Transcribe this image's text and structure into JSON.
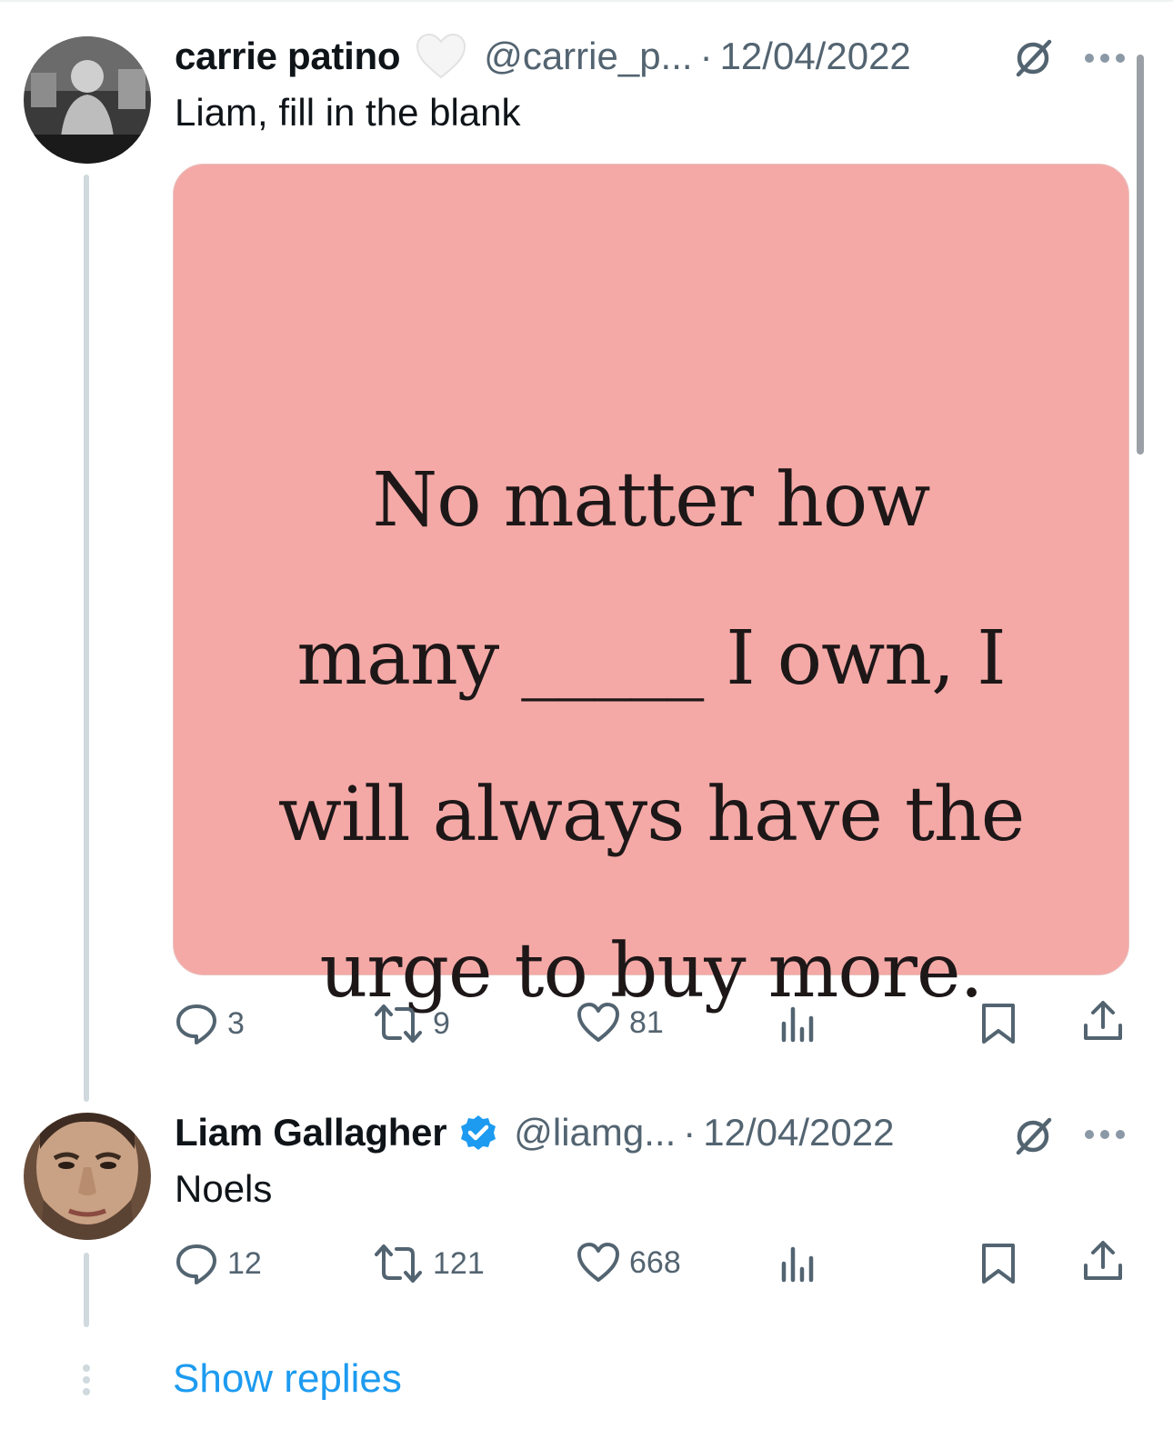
{
  "tweets": [
    {
      "author": "carrie patino",
      "handle": "@carrie_p...",
      "separator": "·",
      "date": "12/04/2022",
      "text": "Liam, fill in the blank",
      "badge": "white-heart-icon",
      "media": {
        "lines": [
          "No matter how",
          "many _____ I own, I",
          "will always have the",
          "urge to buy more."
        ],
        "background": "#f4a9a6"
      },
      "stats": {
        "replies": "3",
        "reposts": "9",
        "likes": "81"
      }
    },
    {
      "author": "Liam Gallagher",
      "handle": "@liamg...",
      "separator": "·",
      "date": "12/04/2022",
      "text": "Noels",
      "badge": "verified-badge-icon",
      "stats": {
        "replies": "12",
        "reposts": "121",
        "likes": "668"
      }
    }
  ],
  "show_replies": "Show replies",
  "colors": {
    "accent": "#1d9bf0",
    "muted": "#536471",
    "text": "#0f1419",
    "thread_line": "#cfd9de"
  }
}
